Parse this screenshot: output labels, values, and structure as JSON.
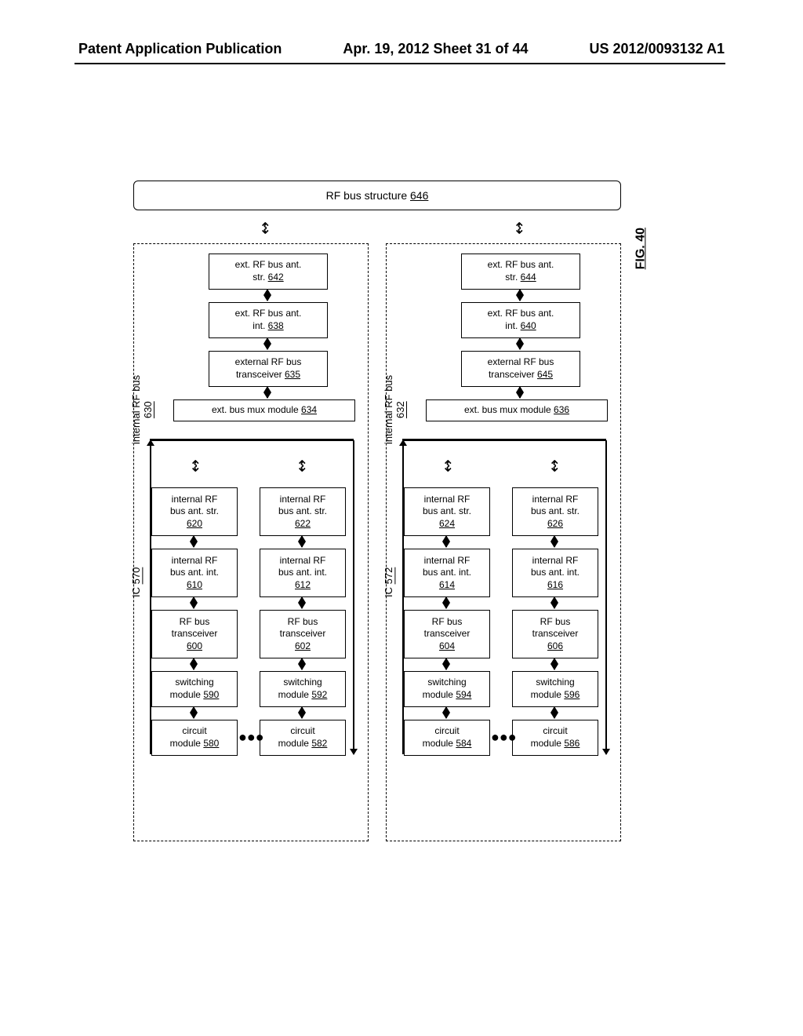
{
  "header": {
    "left": "Patent Application Publication",
    "center": "Apr. 19, 2012  Sheet 31 of 44",
    "right": "US 2012/0093132 A1"
  },
  "fig_label": "FIG. 40",
  "rf_bus": {
    "label": "RF bus structure",
    "ref": "646"
  },
  "ic": {
    "left": {
      "ic_label": "IC",
      "ic_ref": "570",
      "internal_label": "internal RF bus",
      "internal_ref": "630",
      "ext_ant_str": {
        "l1": "ext. RF bus ant.",
        "l2": "str.",
        "ref": "642"
      },
      "ext_ant_int": {
        "l1": "ext. RF bus ant.",
        "l2": "int.",
        "ref": "638"
      },
      "ext_xcvr": {
        "l1": "external RF bus",
        "l2": "transceiver",
        "ref": "635"
      },
      "ext_mux": {
        "l1": "ext. bus mux module",
        "ref": "634"
      },
      "colA": {
        "ant_str": {
          "l1": "internal RF",
          "l2": "bus ant. str.",
          "ref": "620"
        },
        "ant_int": {
          "l1": "internal RF",
          "l2": "bus ant. int.",
          "ref": "610"
        },
        "xcvr": {
          "l1": "RF bus",
          "l2": "transceiver",
          "ref": "600"
        },
        "sw": {
          "l1": "switching",
          "l2": "module",
          "ref": "590"
        },
        "cm": {
          "l1": "circuit",
          "l2": "module",
          "ref": "580"
        }
      },
      "colB": {
        "ant_str": {
          "l1": "internal RF",
          "l2": "bus ant. str.",
          "ref": "622"
        },
        "ant_int": {
          "l1": "internal RF",
          "l2": "bus ant. int.",
          "ref": "612"
        },
        "xcvr": {
          "l1": "RF bus",
          "l2": "transceiver",
          "ref": "602"
        },
        "sw": {
          "l1": "switching",
          "l2": "module",
          "ref": "592"
        },
        "cm": {
          "l1": "circuit",
          "l2": "module",
          "ref": "582"
        }
      }
    },
    "right": {
      "ic_label": "IC",
      "ic_ref": "572",
      "internal_label": "internal RF bus",
      "internal_ref": "632",
      "ext_ant_str": {
        "l1": "ext. RF bus ant.",
        "l2": "str.",
        "ref": "644"
      },
      "ext_ant_int": {
        "l1": "ext. RF bus ant.",
        "l2": "int.",
        "ref": "640"
      },
      "ext_xcvr": {
        "l1": "external RF bus",
        "l2": "transceiver",
        "ref": "645"
      },
      "ext_mux": {
        "l1": "ext. bus mux module",
        "ref": "636"
      },
      "colA": {
        "ant_str": {
          "l1": "internal RF",
          "l2": "bus ant. str.",
          "ref": "624"
        },
        "ant_int": {
          "l1": "internal RF",
          "l2": "bus ant. int.",
          "ref": "614"
        },
        "xcvr": {
          "l1": "RF bus",
          "l2": "transceiver",
          "ref": "604"
        },
        "sw": {
          "l1": "switching",
          "l2": "module",
          "ref": "594"
        },
        "cm": {
          "l1": "circuit",
          "l2": "module",
          "ref": "584"
        }
      },
      "colB": {
        "ant_str": {
          "l1": "internal RF",
          "l2": "bus ant. str.",
          "ref": "626"
        },
        "ant_int": {
          "l1": "internal RF",
          "l2": "bus ant. int.",
          "ref": "616"
        },
        "xcvr": {
          "l1": "RF bus",
          "l2": "transceiver",
          "ref": "606"
        },
        "sw": {
          "l1": "switching",
          "l2": "module",
          "ref": "596"
        },
        "cm": {
          "l1": "circuit",
          "l2": "module",
          "ref": "586"
        }
      }
    }
  },
  "dots": "●●●"
}
